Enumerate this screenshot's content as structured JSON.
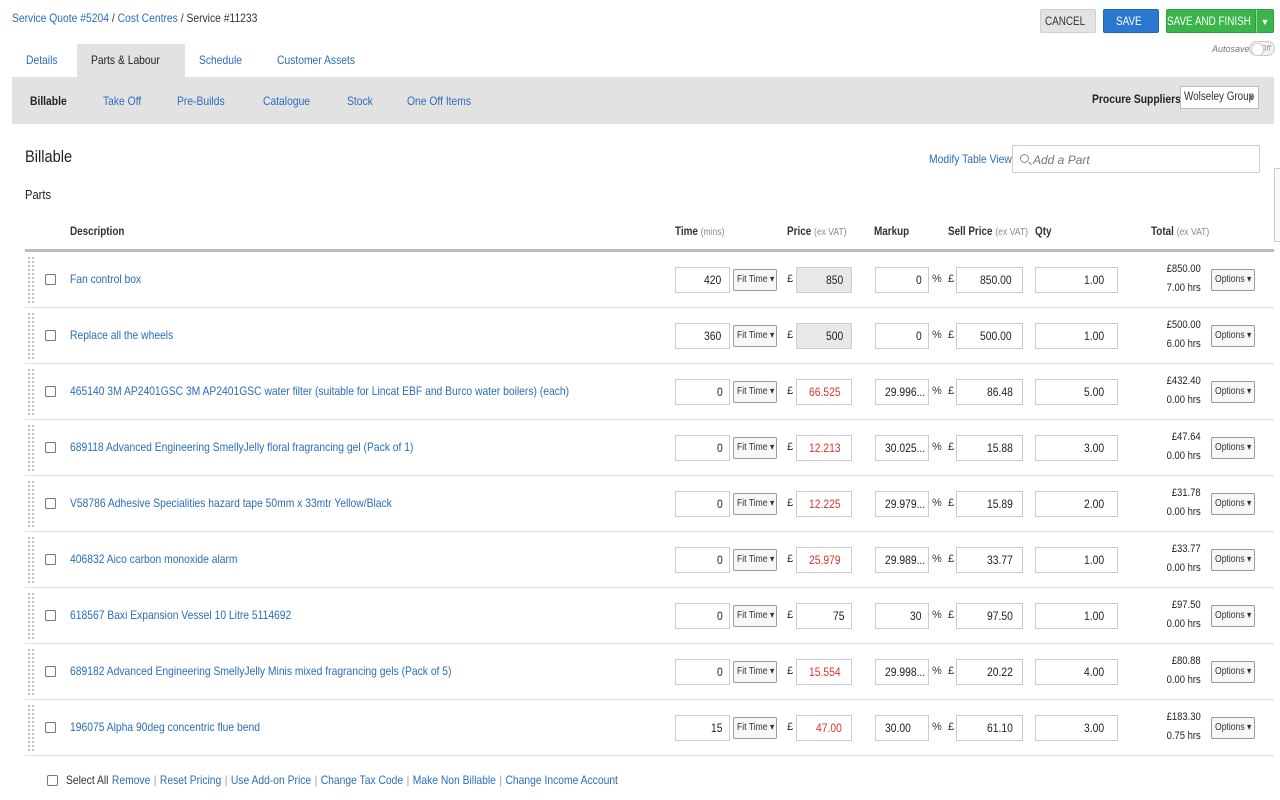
{
  "breadcrumb": {
    "items": [
      "Service Quote #5204",
      "Cost Centres"
    ],
    "separator": "/",
    "current": "Service #11233"
  },
  "actions": {
    "cancel": "CANCEL",
    "save": "SAVE",
    "save_finish": "SAVE AND FINISH",
    "dropdown_icon": "▼"
  },
  "autosave": {
    "label": "Autosave",
    "state": "Off"
  },
  "tabs": [
    {
      "label": "Details",
      "active": false
    },
    {
      "label": "Parts & Labour",
      "active": true
    },
    {
      "label": "Schedule",
      "active": false
    },
    {
      "label": "Customer Assets",
      "active": false
    }
  ],
  "subtabs": [
    {
      "label": "Billable",
      "active": true
    },
    {
      "label": "Take Off",
      "active": false
    },
    {
      "label": "Pre-Builds",
      "active": false
    },
    {
      "label": "Catalogue",
      "active": false
    },
    {
      "label": "Stock",
      "active": false
    },
    {
      "label": "One Off Items",
      "active": false
    }
  ],
  "procure": {
    "label": "Procure Suppliers:",
    "value": "Wolseley Group"
  },
  "page": {
    "title": "Billable",
    "modify_table": "Modify Table View",
    "search_placeholder": "Add a Part",
    "section": "Parts"
  },
  "columns": {
    "description": "Description",
    "time": "Time",
    "time_unit": "(mins)",
    "price": "Price",
    "price_unit": "(ex VAT)",
    "markup": "Markup",
    "sell": "Sell Price",
    "sell_unit": "(ex VAT)",
    "qty": "Qty",
    "total": "Total",
    "total_unit": "(ex VAT)"
  },
  "row_labels": {
    "time_type": "Fit Time ▾",
    "currency": "£",
    "percent": "%",
    "options": "Options ▾"
  },
  "rows": [
    {
      "description": "Fan control box",
      "time": "420",
      "price": "850",
      "price_style": "grey",
      "markup": "0",
      "sell": "850.00",
      "qty": "1.00",
      "total": "£850.00",
      "hours": "7.00 hrs"
    },
    {
      "description": "Replace all the wheels",
      "time": "360",
      "price": "500",
      "price_style": "grey",
      "markup": "0",
      "sell": "500.00",
      "qty": "1.00",
      "total": "£500.00",
      "hours": "6.00 hrs"
    },
    {
      "description": "465140 3M AP2401GSC 3M AP2401GSC water filter (suitable for Lincat EBF and Burco water boilers) (each)",
      "time": "0",
      "price": "66.525",
      "price_style": "red",
      "markup": "29.996...",
      "sell": "86.48",
      "qty": "5.00",
      "total": "£432.40",
      "hours": "0.00 hrs"
    },
    {
      "description": "689118 Advanced Engineering SmellyJelly floral fragrancing gel (Pack of 1)",
      "time": "0",
      "price": "12.213",
      "price_style": "red",
      "markup": "30.025...",
      "sell": "15.88",
      "qty": "3.00",
      "total": "£47.64",
      "hours": "0.00 hrs"
    },
    {
      "description": "V58786 Adhesive Specialities hazard tape 50mm x 33mtr Yellow/Black",
      "time": "0",
      "price": "12.225",
      "price_style": "red",
      "markup": "29.979...",
      "sell": "15.89",
      "qty": "2.00",
      "total": "£31.78",
      "hours": "0.00 hrs"
    },
    {
      "description": "406832 Aico carbon monoxide alarm",
      "time": "0",
      "price": "25.979",
      "price_style": "red",
      "markup": "29.989...",
      "sell": "33.77",
      "qty": "1.00",
      "total": "£33.77",
      "hours": "0.00 hrs"
    },
    {
      "description": "618567 Baxi Expansion Vessel 10 Litre 5114692",
      "time": "0",
      "price": "75",
      "price_style": "normal",
      "markup": "30",
      "sell": "97.50",
      "qty": "1.00",
      "total": "£97.50",
      "hours": "0.00 hrs"
    },
    {
      "description": "689182 Advanced Engineering SmellyJelly Minis mixed fragrancing gels (Pack of 5)",
      "time": "0",
      "price": "15.554",
      "price_style": "red",
      "markup": "29.998...",
      "sell": "20.22",
      "qty": "4.00",
      "total": "£80.88",
      "hours": "0.00 hrs"
    },
    {
      "description": "196075 Alpha 90deg concentric flue bend",
      "time": "15",
      "price": "47.00",
      "price_style": "red",
      "markup": "30.00",
      "sell": "61.10",
      "qty": "3.00",
      "total": "£183.30",
      "hours": "0.75 hrs"
    }
  ],
  "footer": {
    "select_all": "Select All",
    "actions": [
      "Remove",
      "Reset Pricing",
      "Use Add-on Price",
      "Change Tax Code",
      "Make Non Billable",
      "Change Income Account"
    ],
    "separator": "|"
  }
}
